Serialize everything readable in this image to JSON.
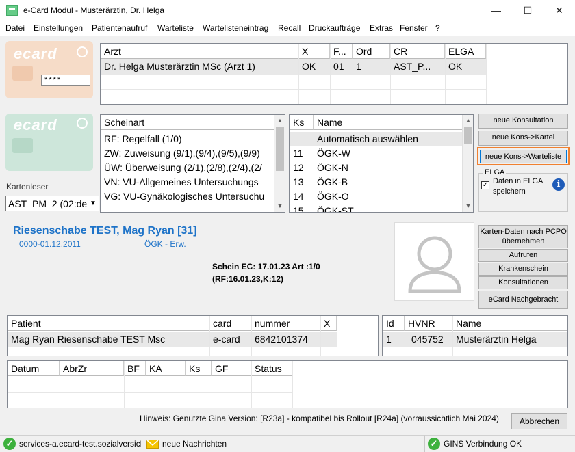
{
  "window": {
    "title": "e-Card Modul - Musterärztin, Dr. Helga",
    "min_symbol": "—",
    "max_symbol": "☐",
    "close_symbol": "✕"
  },
  "menu": [
    "Datei",
    "Einstellungen",
    "Patientenaufruf",
    "Warteliste",
    "Wartelisteneintrag",
    "Recall",
    "Druckaufträge",
    "Extras",
    "Fenster",
    "?"
  ],
  "ecard": {
    "logo": "ecard",
    "pin_mask": "****",
    "reader_label": "Kartenleser",
    "reader_value": "AST_PM_2 (02:de"
  },
  "arzt_table": {
    "headers": [
      "Arzt",
      "X",
      "F...",
      "Ord",
      "CR",
      "ELGA"
    ],
    "rows": [
      [
        "Dr. Helga Musterärztin MSc (Arzt 1)",
        "OK",
        "01",
        "1",
        "AST_P...",
        "OK"
      ]
    ]
  },
  "scheinart": {
    "header": "Scheinart",
    "items": [
      "RF: Regelfall (1/0)",
      "ZW: Zuweisung (9/1),(9/4),(9/5),(9/9)",
      "ÜW: Überweisung (2/1),(2/8),(2/4),(2/",
      "VN: VU-Allgemeines Untersuchungs",
      "VG: VU-Gynäkologisches Untersuchu"
    ]
  },
  "kasse": {
    "headers": [
      "Ks",
      "Name"
    ],
    "rows": [
      [
        "",
        "Automatisch auswählen"
      ],
      [
        "11",
        "ÖGK-W"
      ],
      [
        "12",
        "ÖGK-N"
      ],
      [
        "13",
        "ÖGK-B"
      ],
      [
        "14",
        "ÖGK-O"
      ],
      [
        "15",
        "ÖGK-ST"
      ]
    ]
  },
  "actions": {
    "neue_konsultation": "neue Konsultation",
    "neue_kons_kartei": "neue Kons->Kartei",
    "neue_kons_warteliste": "neue Kons->Warteliste"
  },
  "elga": {
    "group_label": "ELGA",
    "checkbox_label_1": "Daten in ELGA",
    "checkbox_label_2": "speichern",
    "checked": true,
    "info_symbol": "i"
  },
  "patient": {
    "name": "Riesenschabe TEST, Mag Ryan [31]",
    "period": "0000-01.12.2011",
    "insurer": "ÖGK - Erw.",
    "schein_line1": "Schein EC: 17.01.23  Art :1/0",
    "schein_line2": "(RF:16.01.23,K:12)"
  },
  "side_buttons": {
    "karten_daten_1": "Karten-Daten nach PCPO",
    "karten_daten_2": "übernehmen",
    "aufrufen": "Aufrufen",
    "krankenschein": "Krankenschein",
    "konsultationen": "Konsultationen",
    "ecard_nachgebracht": "eCard Nachgebracht"
  },
  "patient_table": {
    "headers": [
      "Patient",
      "card",
      "nummer",
      "X"
    ],
    "rows": [
      [
        "Mag Ryan Riesenschabe TEST Msc",
        "e-card",
        "6842101374",
        ""
      ]
    ]
  },
  "hvnr_table": {
    "headers": [
      "Id",
      "HVNR",
      "Name"
    ],
    "rows": [
      [
        "1",
        "045752",
        "Musterärztin Helga"
      ]
    ]
  },
  "kons_table": {
    "headers": [
      "Datum",
      "AbrZr",
      "BF",
      "KA",
      "Ks",
      "GF",
      "Status"
    ]
  },
  "footer": {
    "hint": "Hinweis: Genutzte Gina Version: [R23a] - kompatibel bis Rollout [R24a] (vorraussichtlich Mai 2024)",
    "cancel": "Abbrechen"
  },
  "statusbar": {
    "service": "services-a.ecard-test.sozialversich",
    "messages": "neue Nachrichten",
    "gins": "GINS Verbindung OK"
  }
}
